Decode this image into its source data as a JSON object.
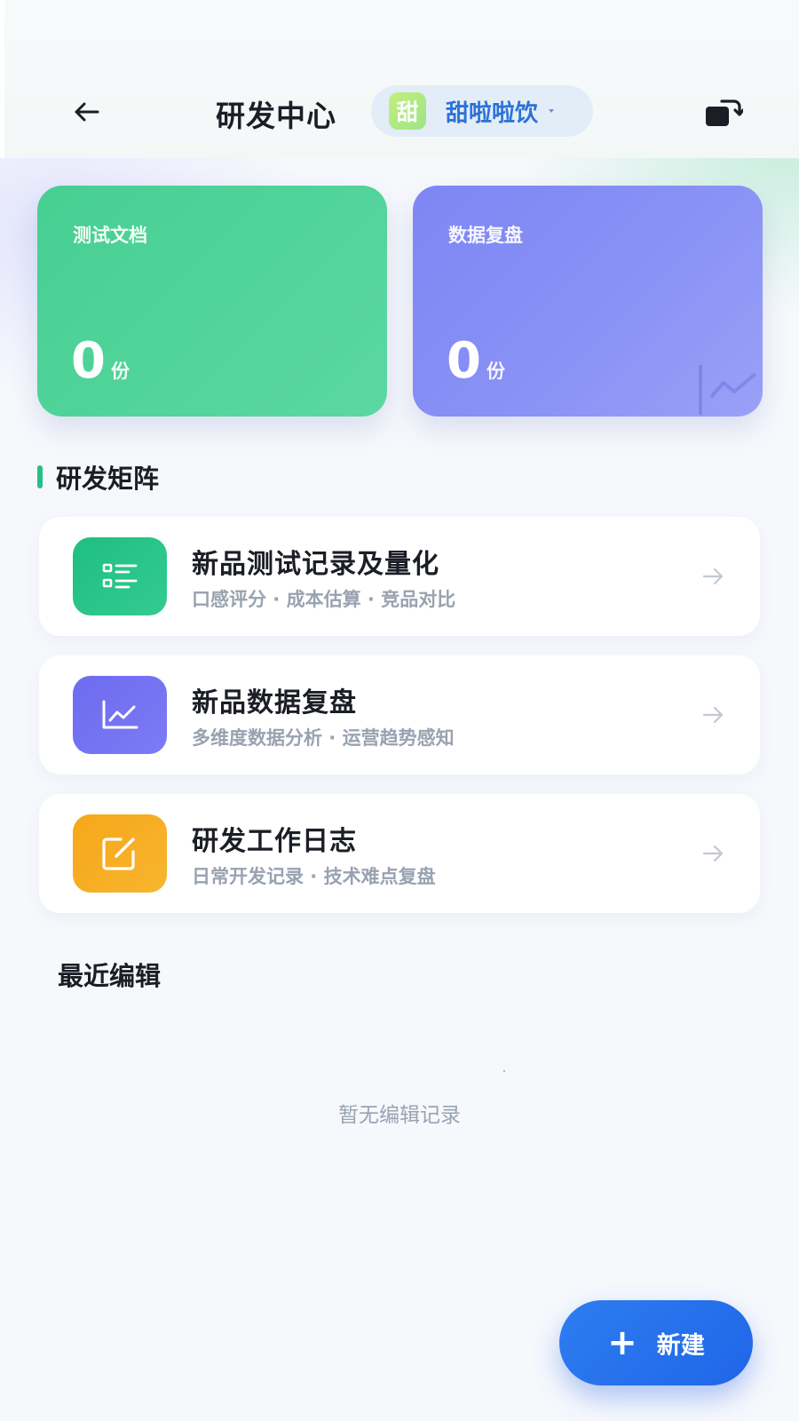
{
  "header": {
    "title": "研发中心",
    "brand": {
      "logo_text": "甜",
      "name": "甜啦啦饮"
    }
  },
  "stats": [
    {
      "label": "测试文档",
      "value": "0",
      "unit": "份"
    },
    {
      "label": "数据复盘",
      "value": "0",
      "unit": "份"
    }
  ],
  "matrix": {
    "title": "研发矩阵",
    "items": [
      {
        "title": "新品测试记录及量化",
        "subtitle": "口感评分 · 成本估算 · 竞品对比"
      },
      {
        "title": "新品数据复盘",
        "subtitle": "多维度数据分析 · 运营趋势感知"
      },
      {
        "title": "研发工作日志",
        "subtitle": "日常开发记录 · 技术难点复盘"
      }
    ]
  },
  "recent": {
    "title": "最近编辑",
    "empty_text": "暂无编辑记录"
  },
  "fab": {
    "icon": "+",
    "label": "新建"
  },
  "colors": {
    "accent_green": "#23c187",
    "accent_purple": "#7d86f3",
    "accent_orange": "#f5a71a",
    "primary_blue": "#1f66e8"
  }
}
